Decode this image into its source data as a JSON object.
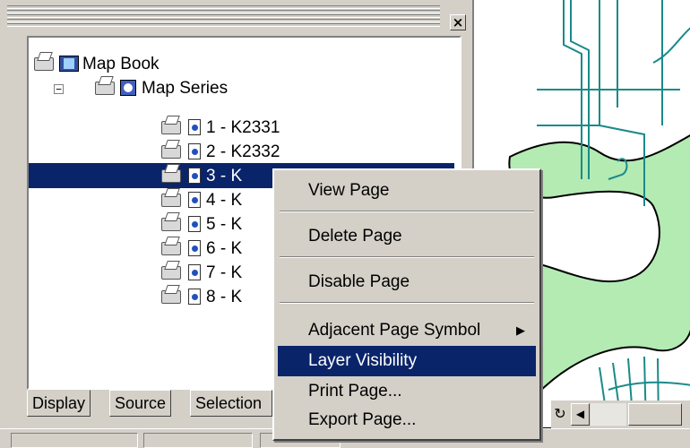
{
  "tree": {
    "root": {
      "label": "Map Book"
    },
    "series": {
      "label": "Map Series",
      "expander": "−"
    },
    "pages": [
      {
        "label": "1 - K2331"
      },
      {
        "label": "2 - K2332"
      },
      {
        "label": "3 - K"
      },
      {
        "label": "4 - K"
      },
      {
        "label": "5 - K"
      },
      {
        "label": "6 - K"
      },
      {
        "label": "7 - K"
      },
      {
        "label": "8 - K"
      }
    ]
  },
  "tabs": [
    {
      "label": "Display"
    },
    {
      "label": "Source"
    },
    {
      "label": "Selection"
    }
  ],
  "close_glyph": "×",
  "context_menu": {
    "items": [
      {
        "label": "View Page"
      },
      {
        "label": "Delete Page"
      },
      {
        "label": "Disable Page"
      },
      {
        "label": "Adjacent Page Symbol",
        "submenu_arrow": "▶"
      },
      {
        "label": "Layer Visibility",
        "highlighted": true
      },
      {
        "label": "Print Page..."
      },
      {
        "label": "Export Page..."
      }
    ]
  },
  "map": {
    "scroll_refresh_glyph": "↻",
    "scroll_left_glyph": "◀"
  },
  "colors": {
    "selection": "#0a246a",
    "map_land": "#b3ebb3",
    "map_roads": "#1a8a8a"
  }
}
